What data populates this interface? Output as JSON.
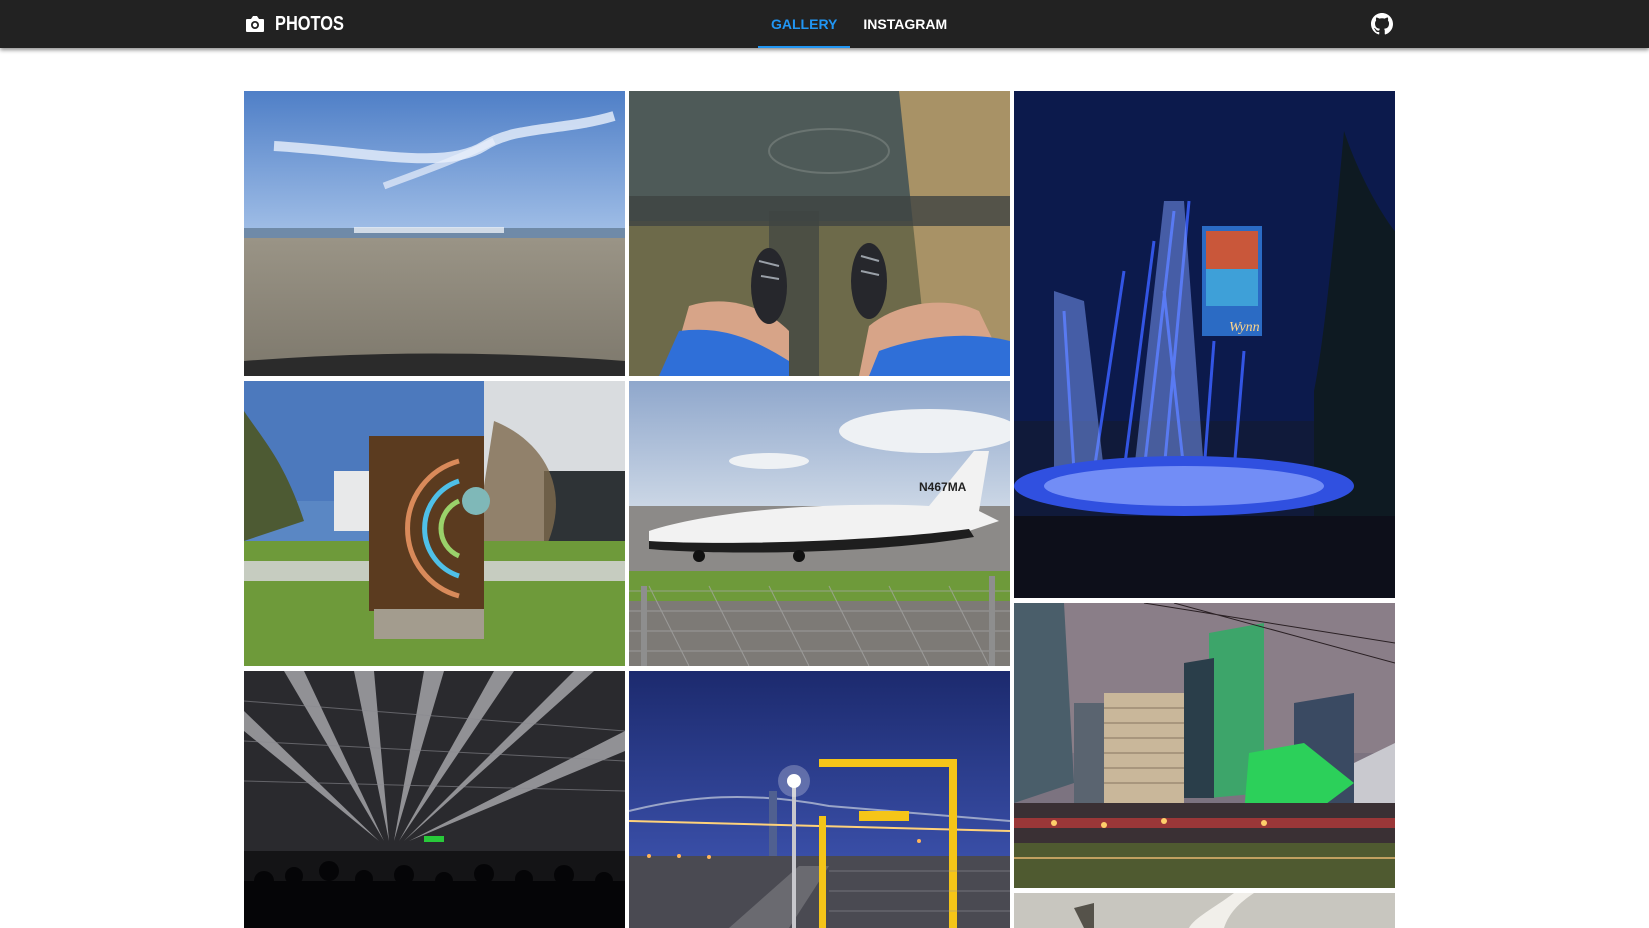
{
  "navbar": {
    "brand": {
      "label": "PHOTOS",
      "icon": "camera-icon"
    },
    "tabs": [
      {
        "label": "GALLERY",
        "active": true
      },
      {
        "label": "INSTAGRAM",
        "active": false
      }
    ],
    "github": {
      "icon": "github-icon"
    },
    "colors": {
      "background": "#222222",
      "active_tab": "#2196f3",
      "text": "#ffffff"
    }
  },
  "gallery": {
    "photos": [
      {
        "subject": "beach-sky"
      },
      {
        "subject": "feet-over-water"
      },
      {
        "subject": "fountain-night"
      },
      {
        "subject": "sculpture-rings"
      },
      {
        "subject": "airplane-tarmac"
      },
      {
        "subject": "concert-lights"
      },
      {
        "subject": "bay-bridge-night"
      },
      {
        "subject": "city-skyline-night"
      },
      {
        "subject": "partial-photo"
      }
    ]
  }
}
